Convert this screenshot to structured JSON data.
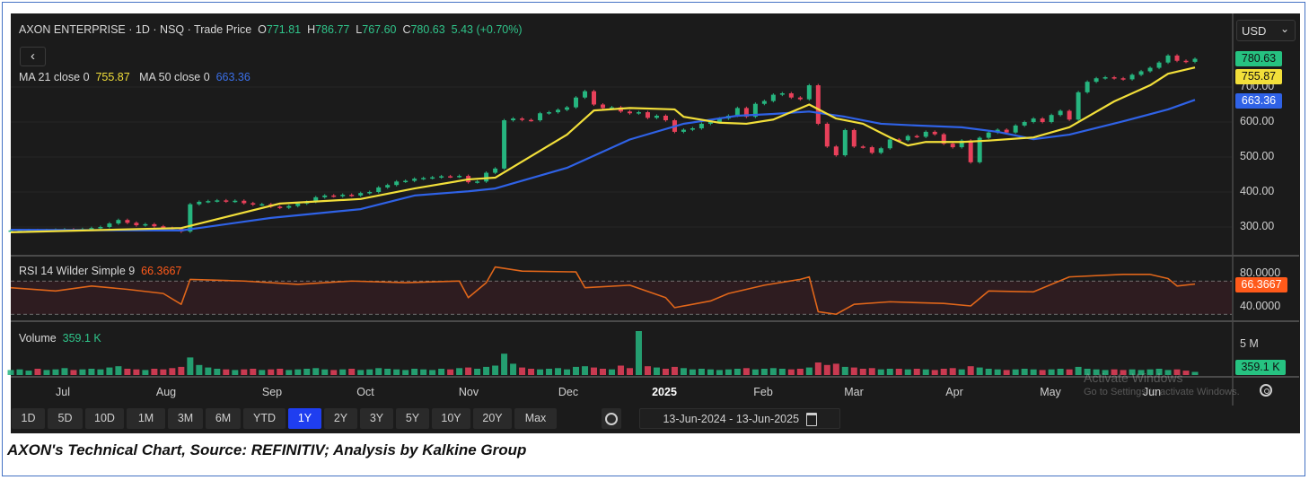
{
  "header": {
    "symbol": "AXON ENTERPRISE",
    "interval": "1D",
    "exchange": "NSQ",
    "price_type": "Trade Price",
    "sep": "·",
    "open_label": "O",
    "open": "771.81",
    "high_label": "H",
    "high": "786.77",
    "low_label": "L",
    "low": "767.60",
    "close_label": "C",
    "close": "780.63",
    "change": "5.43 (+0.70%)"
  },
  "back_icon": "‹",
  "ma": {
    "ma21_label": "MA 21 close 0",
    "ma21_value": "755.87",
    "ma50_label": "MA 50 close 0",
    "ma50_value": "663.36"
  },
  "currency": {
    "value": "USD",
    "chevron": "⌄"
  },
  "badges": {
    "close": "780.63",
    "ma21": "755.87",
    "ma50": "663.36",
    "rsi": "66.3667",
    "volume": "359.1 K"
  },
  "rsi_pane": {
    "label": "RSI 14 Wilder Simple 9",
    "value": "66.3667",
    "ticks": [
      "80.0000",
      "40.0000"
    ]
  },
  "volume_pane": {
    "label": "Volume",
    "value": "359.1 K",
    "tick": "5 M"
  },
  "months": [
    "Jul",
    "Aug",
    "Sep",
    "Oct",
    "Nov",
    "Dec",
    "2025",
    "Feb",
    "Mar",
    "Apr",
    "May",
    "Jun"
  ],
  "toolbar": {
    "ranges": [
      "1D",
      "5D",
      "10D",
      "1M",
      "3M",
      "6M",
      "YTD",
      "1Y",
      "2Y",
      "3Y",
      "5Y",
      "10Y",
      "20Y",
      "Max"
    ],
    "active": "1Y",
    "date_from": "13-Jun-2024",
    "date_sep": "-",
    "date_to": "13-Jun-2025"
  },
  "watermark": {
    "line1": "Activate Windows",
    "line2": "Go to Settings to activate Windows."
  },
  "caption": "AXON's Technical Chart, Source: REFINITIV; Analysis by Kalkine Group",
  "colors": {
    "up": "#26b57f",
    "down": "#e8405a",
    "ma21": "#f2df3a",
    "ma50": "#2f62e6",
    "rsi": "#e0661a",
    "panel": "#1b1b1b"
  },
  "chart_data": {
    "type": "candlestick",
    "title": "AXON ENTERPRISE · 1D · NSQ · Trade Price",
    "x_range": [
      "13-Jun-2024",
      "13-Jun-2025"
    ],
    "price_axis": {
      "ticks": [
        "300.00",
        "400.00",
        "500.00",
        "600.00",
        "700.00"
      ],
      "ylim": [
        260,
        830
      ]
    },
    "closes": [
      290,
      290,
      291,
      289,
      291,
      292,
      293,
      292,
      294,
      297,
      300,
      310,
      320,
      312,
      305,
      308,
      302,
      297,
      295,
      287,
      365,
      372,
      374,
      376,
      373,
      375,
      368,
      364,
      365,
      358,
      355,
      360,
      367,
      372,
      385,
      390,
      388,
      392,
      390,
      397,
      400,
      413,
      420,
      430,
      432,
      438,
      440,
      442,
      445,
      444,
      446,
      428,
      430,
      455,
      467,
      605,
      610,
      606,
      605,
      625,
      628,
      635,
      642,
      670,
      688,
      650,
      640,
      642,
      630,
      625,
      628,
      612,
      618,
      605,
      572,
      578,
      582,
      595,
      600,
      610,
      618,
      640,
      615,
      652,
      660,
      678,
      682,
      670,
      665,
      705,
      595,
      530,
      505,
      577,
      530,
      528,
      512,
      525,
      550,
      548,
      560,
      558,
      572,
      565,
      538,
      528,
      547,
      485,
      555,
      570,
      578,
      570,
      590,
      600,
      610,
      600,
      620,
      632,
      607,
      685,
      715,
      725,
      728,
      725,
      722,
      735,
      745,
      755,
      770,
      790,
      775,
      772,
      780.63
    ],
    "ma21": [
      [
        0,
        285
      ],
      [
        19,
        297
      ],
      [
        30,
        367
      ],
      [
        39,
        380
      ],
      [
        45,
        410
      ],
      [
        51,
        436
      ],
      [
        54,
        441
      ],
      [
        62,
        564
      ],
      [
        65,
        633
      ],
      [
        69,
        640
      ],
      [
        74,
        636
      ],
      [
        75,
        615
      ],
      [
        79,
        598
      ],
      [
        82,
        595
      ],
      [
        85,
        607
      ],
      [
        89,
        650
      ],
      [
        92,
        610
      ],
      [
        95,
        595
      ],
      [
        98,
        556
      ],
      [
        100,
        533
      ],
      [
        102,
        543
      ],
      [
        106,
        543
      ],
      [
        109,
        547
      ],
      [
        114,
        556
      ],
      [
        118,
        585
      ],
      [
        123,
        659
      ],
      [
        127,
        705
      ],
      [
        129,
        738
      ],
      [
        132,
        755.87
      ]
    ],
    "ma50": [
      [
        0,
        292
      ],
      [
        19,
        290
      ],
      [
        29,
        326
      ],
      [
        39,
        351
      ],
      [
        45,
        390
      ],
      [
        51,
        402
      ],
      [
        54,
        410
      ],
      [
        62,
        469
      ],
      [
        69,
        550
      ],
      [
        75,
        595
      ],
      [
        81,
        618
      ],
      [
        85,
        623
      ],
      [
        89,
        630
      ],
      [
        93,
        615
      ],
      [
        97,
        595
      ],
      [
        101,
        590
      ],
      [
        106,
        585
      ],
      [
        110,
        572
      ],
      [
        114,
        551
      ],
      [
        118,
        564
      ],
      [
        124,
        602
      ],
      [
        129,
        636
      ],
      [
        132,
        663.36
      ]
    ],
    "rsi": {
      "ylim": [
        20,
        100
      ],
      "bands": [
        70,
        30
      ],
      "points": [
        [
          0,
          62
        ],
        [
          5,
          58
        ],
        [
          9,
          64
        ],
        [
          13,
          60
        ],
        [
          17,
          55
        ],
        [
          19,
          42
        ],
        [
          20,
          72
        ],
        [
          26,
          70
        ],
        [
          32,
          66
        ],
        [
          38,
          70
        ],
        [
          44,
          68
        ],
        [
          50,
          70
        ],
        [
          51,
          50
        ],
        [
          53,
          68
        ],
        [
          54,
          87
        ],
        [
          57,
          82
        ],
        [
          63,
          81
        ],
        [
          64,
          62
        ],
        [
          69,
          65
        ],
        [
          73,
          50
        ],
        [
          74,
          38
        ],
        [
          78,
          46
        ],
        [
          80,
          55
        ],
        [
          84,
          65
        ],
        [
          88,
          72
        ],
        [
          89,
          75
        ],
        [
          90,
          33
        ],
        [
          92,
          30
        ],
        [
          94,
          42
        ],
        [
          98,
          45
        ],
        [
          104,
          43
        ],
        [
          107,
          40
        ],
        [
          109,
          58
        ],
        [
          114,
          57
        ],
        [
          118,
          75
        ],
        [
          124,
          78
        ],
        [
          127,
          78
        ],
        [
          129,
          73
        ],
        [
          130,
          64
        ],
        [
          132,
          66.37
        ]
      ]
    },
    "volume_millions": [
      0.8,
      0.9,
      0.7,
      1.0,
      0.8,
      0.9,
      1.1,
      0.8,
      0.9,
      1.0,
      0.9,
      1.2,
      1.4,
      1.0,
      0.9,
      0.8,
      1.0,
      0.9,
      1.1,
      1.3,
      2.8,
      1.6,
      1.2,
      1.0,
      0.9,
      0.8,
      0.9,
      1.0,
      0.8,
      0.9,
      1.0,
      0.8,
      0.9,
      1.0,
      1.1,
      0.9,
      0.8,
      0.9,
      1.0,
      0.8,
      0.9,
      1.1,
      1.0,
      0.9,
      0.8,
      1.0,
      0.9,
      0.8,
      1.0,
      0.9,
      1.1,
      1.2,
      1.0,
      1.3,
      1.5,
      3.4,
      1.8,
      1.2,
      1.0,
      0.9,
      1.0,
      1.1,
      0.9,
      1.3,
      1.4,
      1.2,
      1.0,
      0.9,
      1.5,
      1.1,
      7.0,
      1.4,
      1.2,
      1.0,
      1.3,
      1.1,
      0.9,
      1.0,
      0.9,
      0.8,
      0.9,
      1.0,
      1.1,
      0.9,
      1.0,
      1.1,
      1.0,
      0.9,
      1.0,
      1.2,
      2.0,
      1.6,
      1.8,
      1.3,
      1.2,
      1.0,
      1.1,
      0.9,
      1.0,
      1.0,
      0.9,
      1.0,
      0.9,
      0.8,
      1.0,
      1.1,
      0.9,
      1.4,
      1.2,
      1.0,
      0.9,
      0.8,
      0.9,
      1.0,
      0.9,
      0.8,
      0.9,
      1.0,
      0.9,
      1.3,
      1.0,
      0.9,
      0.8,
      0.9,
      0.8,
      0.9,
      0.8,
      0.9,
      1.0,
      0.8,
      0.9,
      0.7,
      0.5
    ]
  }
}
